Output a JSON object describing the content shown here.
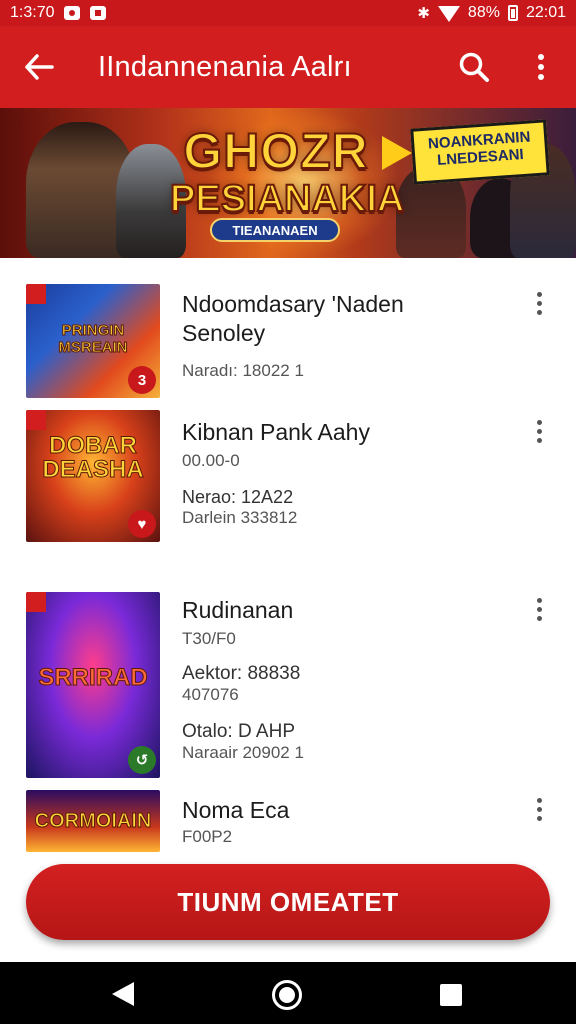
{
  "status_bar": {
    "time": "1:3:70",
    "battery": "88%",
    "clock_right": "22:01",
    "icons": [
      "dot-square-icon",
      "square-icon",
      "bluetooth-icon",
      "wifi-icon",
      "battery-icon"
    ]
  },
  "app_bar": {
    "title": "IIndannenania Aalrı",
    "icons": [
      "back-arrow-icon",
      "search-icon",
      "more-vert-icon"
    ]
  },
  "banner": {
    "title_line1": "GHOZR",
    "title_line2": "PESIANAKIA",
    "subtitle": "TIEANANAEN",
    "tag": "NOANKRANIN LNEDESANI"
  },
  "items": [
    {
      "title_line1": "Ndoomdasary 'Naden",
      "title_line2": "Senoley",
      "meta": "Naradı: 18022 1",
      "thumb_text": "PRINGIN MSREAIN",
      "badge": "3"
    },
    {
      "title": "Kibnan Pank Aahy",
      "meta1": "00.00-0",
      "meta2": "Nerao: 12A22",
      "meta3": "Darlein 333812",
      "thumb_text": "DOBAR DEASHA",
      "badge": "♥"
    },
    {
      "title": "Rudinanan",
      "meta1": "T30/F0",
      "meta2": "Aektor: 88838",
      "meta3": "407076",
      "meta4": "Otalo: D AHP",
      "meta5": "Naraair 20902 1",
      "thumb_text": "SRRIRAD",
      "badge": "↺"
    },
    {
      "title": "Noma Eca",
      "meta1": "F00P2",
      "thumb_text": "CORMOIAIN"
    }
  ],
  "cta": {
    "label": "TIUNM OMEATET"
  },
  "nav": {
    "icons": [
      "back-triangle-icon",
      "home-circle-icon",
      "recents-square-icon"
    ]
  },
  "colors": {
    "primary": "#d21e1e",
    "status_bar": "#c8181c",
    "nav_bar": "#000000"
  }
}
